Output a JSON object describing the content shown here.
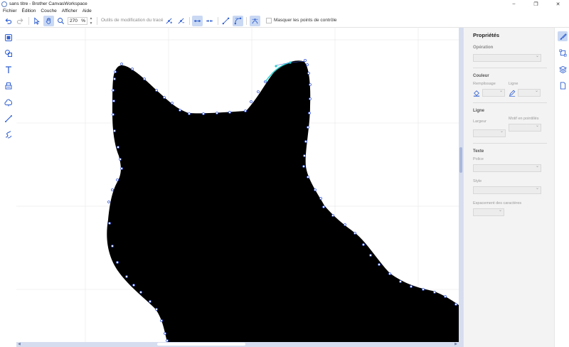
{
  "window": {
    "title": "sans titre - Brother CanvasWorkspace",
    "controls": [
      "–",
      "❐",
      "✕"
    ]
  },
  "menu": [
    "Fichier",
    "Édition",
    "Couche",
    "Afficher",
    "Aide"
  ],
  "toolbar": {
    "zoom_value": "270",
    "zoom_unit": "%",
    "path_tools_label": "Outils de modification du tracé",
    "hide_control_points_label": "Masquer les points de contrôle",
    "accent": "#2f5fd0",
    "active_bg": "#c9d8f3"
  },
  "left_tools": [
    "select-shape-icon",
    "shapes-icon",
    "text-icon",
    "stamp-icon",
    "fill-shape-icon",
    "line-icon",
    "freehand-icon"
  ],
  "properties": {
    "title": "Propriétés",
    "operation_heading": "Opération",
    "colour_heading": "Couleur",
    "fill_label": "Remplissage",
    "line_label": "Ligne",
    "line_heading": "Ligne",
    "width_label": "Largeur",
    "dash_label": "Motif en pointillés",
    "text_heading": "Texte",
    "font_label": "Police",
    "style_label": "Style",
    "spacing_label": "Espacement des caractères"
  },
  "right_rail": [
    "properties-brush-icon",
    "transform-icon",
    "layers-icon",
    "page-icon"
  ],
  "shape_color": "#000000",
  "node_color": "#3a5ad9",
  "selected_segment_color": "#2ad1d1"
}
